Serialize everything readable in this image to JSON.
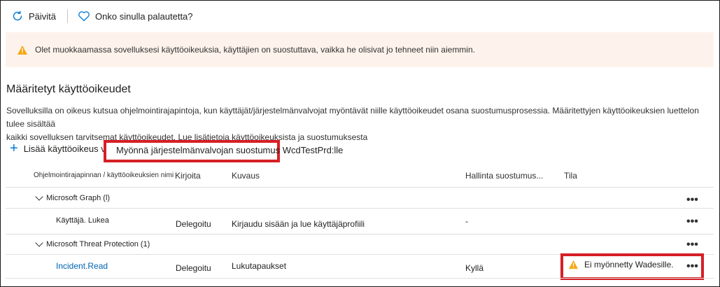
{
  "toolbar": {
    "refresh_label": "Päivitä",
    "feedback_label": "Onko sinulla palautetta?"
  },
  "banner": {
    "message": "Olet muokkaamassa sovelluksesi käyttöoikeuksia, käyttäjien on suostuttava, vaikka he olisivat jo tehneet niin aiemmin."
  },
  "section": {
    "title": "Määritetyt käyttöoikeudet",
    "description_line1": "Sovelluksilla on oikeus kutsua ohjelmointirajapintoja, kun käyttäjät/järjestelmänvalvojat myöntävät niille käyttöoikeudet osana suostumusprosessia. Määritettyjen käyttöoikeuksien luettelon tulee sisältää",
    "description_line2": "kaikki sovelluksen tarvitsemat käyttöoikeudet. Lue lisätietoja käyttöoikeuksista ja suostumuksesta"
  },
  "actions": {
    "add_permission_label": "Lisää käyttöoikeus v",
    "grant_consent_label": "Myönnä järjestelmänvalvojan suostumus WcdTestPrd:lle"
  },
  "table": {
    "headers": {
      "api_name": "Ohjelmointirajapinnan / käyttöoikeuksien nimi",
      "type": "Kirjoita",
      "description": "Kuvaus",
      "admin_consent": "Hallinta suostumus...",
      "status": "Tila"
    },
    "groups": [
      {
        "name": "Microsoft Graph (l)",
        "rows": [
          {
            "name": "Käyttäjä. Lukea",
            "type": "Delegoitu",
            "description": "Kirjaudu sisään ja lue käyttäjäprofiili",
            "admin_consent": "-",
            "status": ""
          }
        ]
      },
      {
        "name": "Microsoft Threat Protection (1)",
        "rows": [
          {
            "name": "Incident.Read",
            "type": "Delegoitu",
            "description": "Lukutapaukset",
            "admin_consent": "Kyllä",
            "status": "Ei myönnetty Wadesille."
          }
        ]
      }
    ],
    "more_label": "•••"
  },
  "colors": {
    "accent": "#0078d4",
    "link": "#0063b1",
    "warning": "#f7a711",
    "highlight": "#d61f26",
    "banner_bg": "#fdf3ec"
  },
  "icons": {
    "refresh": "refresh-icon",
    "feedback": "heart-icon",
    "warning": "warning-icon",
    "add": "plus-icon",
    "expand": "chevron-down-icon",
    "more": "more-icon"
  }
}
